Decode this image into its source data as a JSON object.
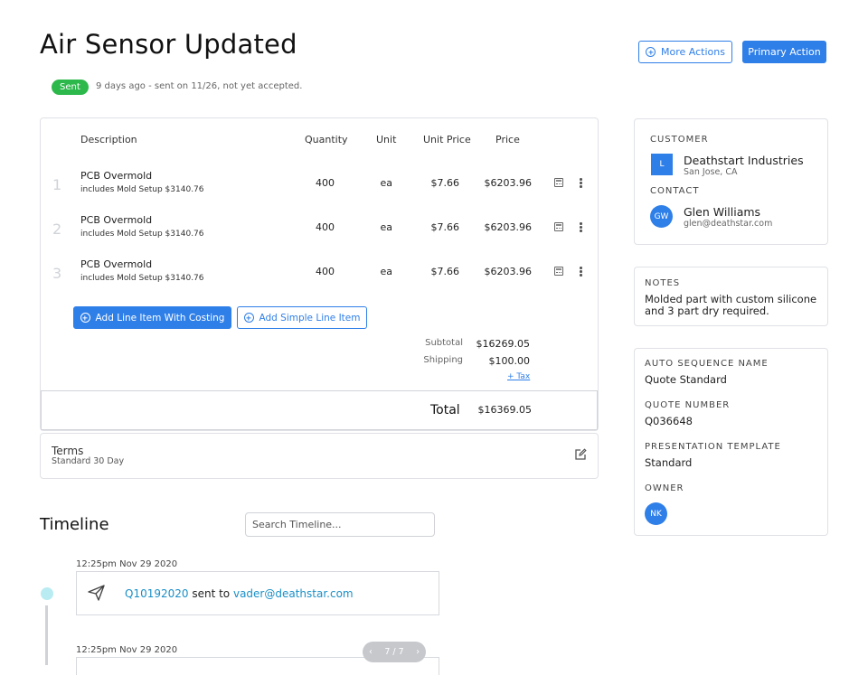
{
  "page": {
    "title": "Air Sensor Updated",
    "badge": "Sent",
    "status_text": "9 days ago - sent on 11/26, not yet accepted."
  },
  "actions": {
    "more_label": "More Actions",
    "primary_label": "Primary Action"
  },
  "table": {
    "headers": {
      "description": "Description",
      "quantity": "Quantity",
      "unit": "Unit",
      "unit_price": "Unit Price",
      "price": "Price"
    },
    "rows": [
      {
        "num": "1",
        "name": "PCB Overmold",
        "sub": "includes Mold Setup $3140.76",
        "quantity": "400",
        "unit": "ea",
        "unit_price": "$7.66",
        "price": "$6203.96"
      },
      {
        "num": "2",
        "name": "PCB Overmold",
        "sub": "includes Mold Setup $3140.76",
        "quantity": "400",
        "unit": "ea",
        "unit_price": "$7.66",
        "price": "$6203.96"
      },
      {
        "num": "3",
        "name": "PCB Overmold",
        "sub": "includes Mold Setup $3140.76",
        "quantity": "400",
        "unit": "ea",
        "unit_price": "$7.66",
        "price": "$6203.96"
      }
    ],
    "add_costing_label": "Add Line Item With Costing",
    "add_simple_label": "Add Simple Line Item",
    "subtotal_label": "Subtotal",
    "subtotal_value": "$16269.05",
    "shipping_label": "Shipping",
    "shipping_value": "$100.00",
    "tax_link": "+ Tax",
    "total_label": "Total",
    "total_value": "$16369.05"
  },
  "terms": {
    "label": "Terms",
    "value": "Standard 30 Day"
  },
  "customer": {
    "label": "CUSTOMER",
    "avatar": "L",
    "name": "Deathstart Industries",
    "location": "San Jose, CA",
    "contact_label": "CONTACT",
    "contact_avatar": "GW",
    "contact_name": "Glen Williams",
    "contact_email": "glen@deathstar.com"
  },
  "notes": {
    "label": "NOTES",
    "text_line1": "Molded part with custom silicone",
    "text_line2": "and 3 part dry required."
  },
  "details": {
    "seq_label": "AUTO SEQUENCE NAME",
    "seq_value": "Quote Standard",
    "quote_label": "QUOTE NUMBER",
    "quote_value": "Q036648",
    "template_label": "PRESENTATION TEMPLATE",
    "template_value": "Standard",
    "owner_label": "OWNER",
    "owner_avatar": "NK"
  },
  "timeline": {
    "title": "Timeline",
    "search_placeholder": "Search Timeline...",
    "events": [
      {
        "time": "12:25pm Nov 29 2020",
        "quote": "Q10192020",
        "mid": " sent to ",
        "email": "vader@deathstar.com"
      },
      {
        "time": "12:25pm Nov 29 2020"
      }
    ],
    "pager": "7 / 7"
  },
  "colors": {
    "accent": "#2f7fe8",
    "badge": "#2db84b",
    "link": "#1a8fc7",
    "timeline_dot": "#b9ecf2"
  }
}
